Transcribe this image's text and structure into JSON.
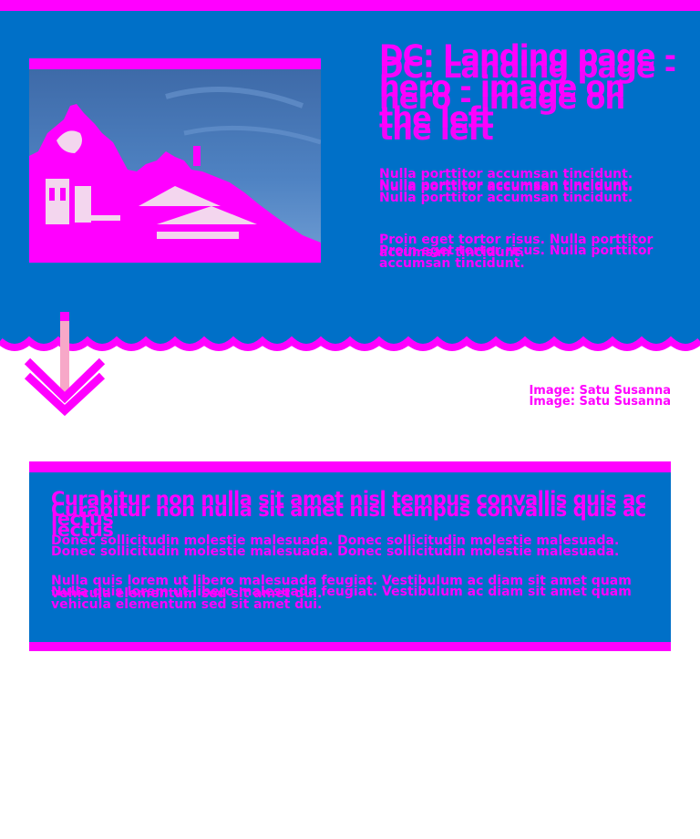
{
  "hero": {
    "title": "DC: Landing page - hero - image on the left",
    "paragraphs": [
      "Nulla porttitor accumsan tincidunt. Nulla porttitor accumsan tincidunt.",
      "Proin eget tortor risus. Nulla porttitor accumsan tincidunt."
    ],
    "image_credit": "Image: Satu Susanna"
  },
  "card": {
    "title": "Curabitur non nulla sit amet nisl tempus convallis quis ac lectus",
    "paragraphs": [
      "Donec sollicitudin molestie malesuada. Donec sollicitudin molestie malesuada.",
      "Nulla quis lorem ut libero malesuada feugiat. Vestibulum ac diam sit amet quam vehicula elementum sed sit amet dui."
    ]
  },
  "icons": {
    "scroll_arrow": "chevron-down-icon"
  },
  "colors": {
    "accent": "#ff00ff",
    "background": "#0070c8",
    "page": "#ffffff",
    "arrow_stem": "#f7a8c8"
  }
}
